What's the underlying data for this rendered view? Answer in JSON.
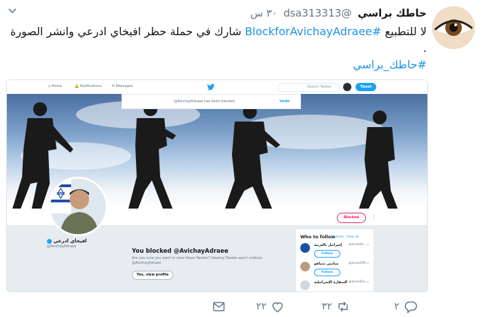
{
  "tweet": {
    "author_name": "حاطك براسي",
    "handle": "@dsa313313",
    "time": "٣٠ س",
    "text_before_tag": "لا للتطبيع ",
    "hashtag_block": "#BlockforAvichayAdraee",
    "text_after_tag": " شارك في حملة حظر افيخاي ادرعي وانشر الصورة .",
    "hashtag_signature": "#حاطك_براسي"
  },
  "embedded": {
    "nav": {
      "home": "Home",
      "notifications": "Notifications",
      "messages": "Messages",
      "search_placeholder": "Search Twitter",
      "tweet_button": "Tweet"
    },
    "toast": {
      "text": "@AvichayAdraee has been blocked.",
      "undo": "Undo"
    },
    "profile": {
      "blocked_button": "Blocked",
      "name": "افيخاي ادرعي",
      "handle": "@AvichayAdraee"
    },
    "blocked_notice": {
      "title": "You blocked @AvichayAdraee",
      "description": "Are you sure you want to view these Tweets? Viewing Tweets won't unblock @AvichayAdraee",
      "button": "Yes, view profile"
    },
    "who_to_follow": {
      "title": "Who to follow",
      "links": "Refresh · View all",
      "items": [
        {
          "name": "إسرائيل بالعربية",
          "handle": "@IsraelAr...",
          "follow": "Follow"
        },
        {
          "name": "بنيامين نتنياهو",
          "handle": "@IsraeliPM...",
          "follow": "Follow"
        },
        {
          "name": "السفارة الإسرائيلية",
          "handle": "@IsraelEm...",
          "follow": "Follow"
        }
      ]
    }
  },
  "actions": {
    "replies": "٢",
    "retweets": "٣٢",
    "likes": "٢٢"
  },
  "colors": {
    "accent": "#1da1f2",
    "hashtag": "#1b95e0",
    "muted": "#657786",
    "blocked": "#e0245e"
  }
}
